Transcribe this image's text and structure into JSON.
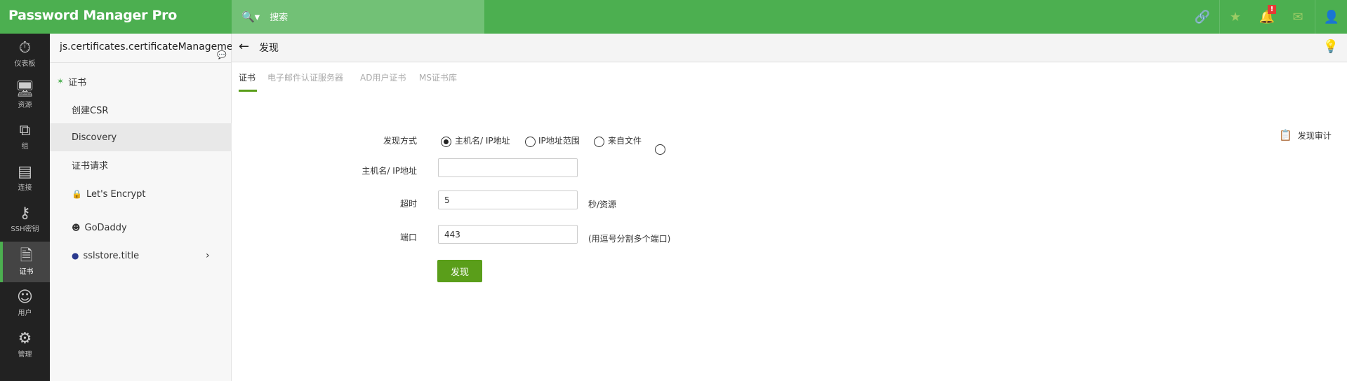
{
  "app": {
    "title": "Password Manager Pro"
  },
  "search": {
    "placeholder": "搜索"
  },
  "nav": [
    {
      "label": "仪表板",
      "icon": "dashboard-icon"
    },
    {
      "label": "资源",
      "icon": "monitor-icon"
    },
    {
      "label": "组",
      "icon": "group-icon"
    },
    {
      "label": "连接",
      "icon": "connection-icon"
    },
    {
      "label": "SSH密钥",
      "icon": "ssh-key-icon"
    },
    {
      "label": "证书",
      "icon": "certificate-icon"
    },
    {
      "label": "用户",
      "icon": "user-icon"
    },
    {
      "label": "管理",
      "icon": "gear-icon"
    }
  ],
  "panel": {
    "title": "js.certificates.certificateManagement",
    "items": [
      {
        "label": "证书"
      },
      {
        "label": "创建CSR"
      },
      {
        "label": "Discovery"
      },
      {
        "label": "证书请求"
      },
      {
        "label": "Let's Encrypt"
      },
      {
        "label": "GoDaddy"
      },
      {
        "label": "sslstore.title"
      }
    ]
  },
  "main": {
    "title": "发现",
    "tabs": [
      "证书",
      "电子邮件认证服务器",
      "AD用户证书",
      "MS证书库"
    ],
    "audit": "发现审计"
  },
  "form": {
    "method_label": "发现方式",
    "methods": [
      "主机名/ IP地址",
      "IP地址范围",
      "来自文件"
    ],
    "selected_method": "主机名/ IP地址",
    "host_label": "主机名/ IP地址",
    "host_value": "",
    "timeout_label": "超时",
    "timeout_value": "5",
    "timeout_unit": "秒/资源",
    "port_label": "端口",
    "port_value": "443",
    "port_hint": "(用逗号分割多个端口)",
    "submit": "发现"
  },
  "header": {
    "notification_badge": "!"
  }
}
